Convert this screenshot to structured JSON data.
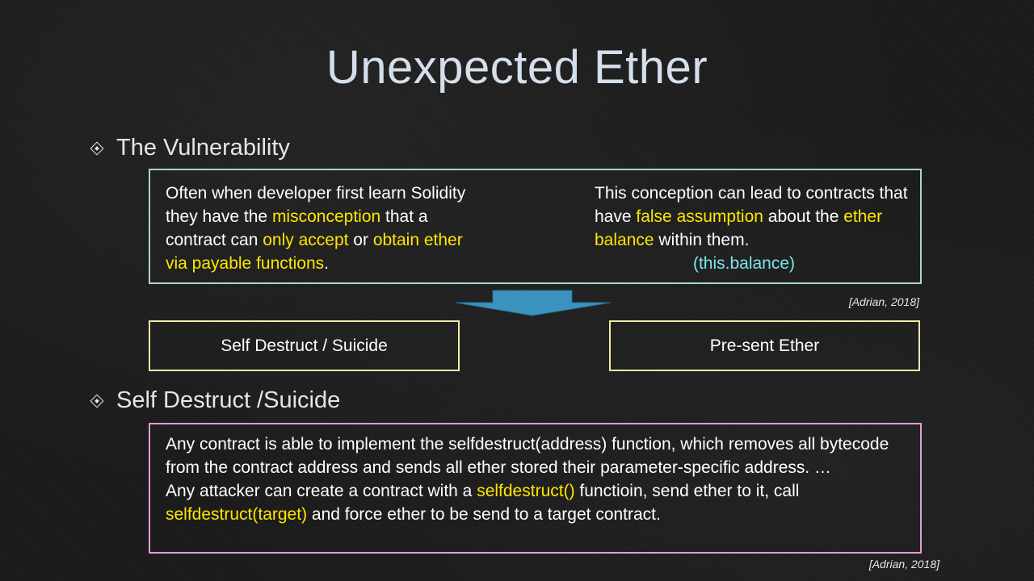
{
  "slide": {
    "title": "Unexpected Ether",
    "section1": {
      "heading": "The Vulnerability",
      "left_parts": [
        "Often when developer first learn Solidity they have the ",
        "misconception",
        " that a contract can ",
        "only accept",
        " or ",
        "obtain ether via payable functions",
        "."
      ],
      "right_parts": [
        "This conception can lead to contracts that have ",
        "false assumption",
        " about the ",
        "ether balance",
        " within them."
      ],
      "right_code": "(this.balance)",
      "citation": "[Adrian, 2018]"
    },
    "options": {
      "left_label": "Self Destruct / Suicide",
      "right_label": "Pre-sent Ether"
    },
    "section2": {
      "heading": "Self Destruct /Suicide",
      "para1": "Any contract is able to implement the selfdestruct(address) function, which removes all bytecode from the contract address and sends all ether stored their parameter-specific address. …",
      "para2_parts": [
        "Any attacker can create a contract with a ",
        "selfdestruct()",
        " functioin, send ether to it, call ",
        "selfdestruct(target)",
        " and force ether to be send to a target contract."
      ],
      "citation": "[Adrian, 2018]"
    },
    "colors": {
      "title": "#d4dfeb",
      "highlight": "#ffe600",
      "code_cyan": "#7fe3ec",
      "box_teal": "#a8d7c6",
      "box_yellow": "#f3e9a6",
      "box_pink": "#e59ad9",
      "arrow": "#3a93bf"
    },
    "icons": {
      "bullet": "diamond-bullet-icon",
      "arrow": "down-arrow-icon"
    }
  }
}
